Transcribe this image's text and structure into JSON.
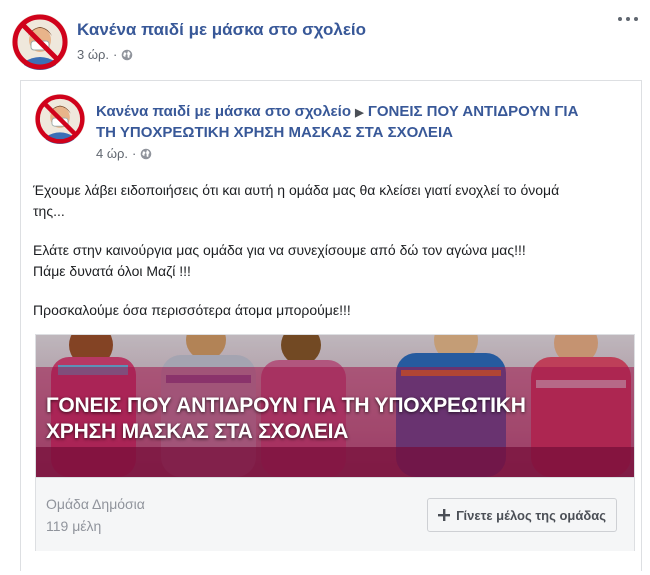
{
  "outer_post": {
    "group_name": "Κανένα παιδί με μάσκα στο σχολείο",
    "time": "3 ώρ.",
    "separator": "·"
  },
  "shared_post": {
    "group_name": "Κανένα παιδί με μάσκα στο σχολείο",
    "arrow": "▶",
    "target_line1": "ΓΟΝΕΙΣ ΠΟΥ ΑΝΤΙΔΡΟΥΝ ΓΙΑ",
    "target_line2": "ΤΗ ΥΠΟΧΡΕΩΤΙΚΗ ΧΡΗΣΗ ΜΑΣΚΑΣ ΣΤΑ ΣΧΟΛΕΙΑ",
    "time": "4 ώρ.",
    "separator": "·",
    "body": {
      "p1_line1": "Έχουμε λάβει ειδοποιήσεις ότι και αυτή η ομάδα μας θα κλείσει γιατί ενοχλεί το όνομά",
      "p1_line2": "της...",
      "p2_line1": "Ελάτε στην καινούργια μας ομάδα για να συνεχίσουμε από δώ τον αγώνα μας!!!",
      "p2_line2": "Πάμε δυνατά όλοι Μαζί !!!",
      "p3": "Προσκαλούμε όσα περισσότερα άτομα μπορούμε!!!"
    }
  },
  "group_card": {
    "title_line1": "ΓΟΝΕΙΣ ΠΟΥ ΑΝΤΙΔΡΟΥΝ ΓΙΑ ΤΗ ΥΠΟΧΡΕΩΤΙΚΗ",
    "title_line2": "ΧΡΗΣΗ ΜΑΣΚΑΣ ΣΤΑ ΣΧΟΛΕΙΑ",
    "privacy": "Ομάδα Δημόσια",
    "members": "119 μέλη",
    "join_icon": "plus-icon",
    "join_label": "Γίνετε μέλος της ομάδας"
  },
  "colors": {
    "link_blue": "#385898",
    "meta_gray": "#616770",
    "border": "#dddfe2",
    "banner_magenta": "#c2185b"
  }
}
